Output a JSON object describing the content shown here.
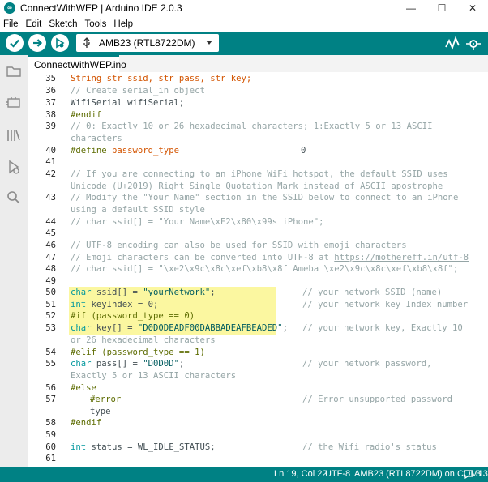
{
  "window": {
    "title": "ConnectWithWEP | Arduino IDE 2.0.3",
    "logo_glyph": "∞",
    "minimize": "—",
    "maximize": "☐",
    "close": "✕"
  },
  "menu": [
    "File",
    "Edit",
    "Sketch",
    "Tools",
    "Help"
  ],
  "toolbar": {
    "board": "AMB23 (RTL8722DM)",
    "accent": "#008184"
  },
  "tab": {
    "label": "ConnectWithWEP.ino"
  },
  "status": {
    "position": "Ln 19, Col 22",
    "encoding": "UTF-8",
    "board_port": "AMB23 (RTL8722DM) on COM13",
    "count": "3"
  },
  "code": {
    "l35_num": "35",
    "l35": "String str_ssid, str_pass, str_key;",
    "l36_num": "36",
    "l36": "// Create serial_in object",
    "l37_num": "37",
    "l37": "WifiSerial wifiSerial;",
    "l38_num": "38",
    "l38": "#endif",
    "l39_num": "39",
    "l39a": "// 0: Exactly 10 or 26 hexadecimal characters; 1:Exactly 5 or 13 ASCII",
    "l39b": "characters",
    "l40_num": "40",
    "l40a": "#define ",
    "l40b": "password_type",
    "l40c": "0",
    "l41_num": "41",
    "l42_num": "42",
    "l42a": "// If you are connecting to an iPhone WiFi hotspot, the default SSID uses",
    "l42b": "Unicode (U+2019) Right Single Quotation Mark instead of ASCII apostrophe",
    "l43_num": "43",
    "l43a": "// Modify the \"Your Name\" section in the SSID below to connect to an iPhone",
    "l43b": "using a default SSID style",
    "l44_num": "44",
    "l44": "// char ssid[] = \"Your Name\\xE2\\x80\\x99s iPhone\";",
    "l45_num": "45",
    "l46_num": "46",
    "l46": "// UTF-8 encoding can also be used for SSID with emoji characters",
    "l47_num": "47",
    "l47a": "// Emoji characters can be converted into UTF-8 at ",
    "l47b": "https://mothereff.in/utf-8",
    "l48_num": "48",
    "l48": "// char ssid[] = \"\\xe2\\x9c\\x8c\\xef\\xb8\\x8f Ameba \\xe2\\x9c\\x8c\\xef\\xb8\\x8f\";",
    "l49_num": "49",
    "l50_num": "50",
    "l50a": "char",
    "l50b": " ssid[] = ",
    "l50c": "\"yourNetwork\"",
    "l50d": ";",
    "l50e": "// your network SSID (name)",
    "l51_num": "51",
    "l51a": "int",
    "l51b": " keyIndex = 0;",
    "l51e": "// your network key Index number",
    "l52_num": "52",
    "l52": "#if (password_type == 0)",
    "l53_num": "53",
    "l53a": "char",
    "l53b": " key[] = ",
    "l53c": "\"D0D0DEADF00DABBADEAFBEADED\"",
    "l53d": ";",
    "l53e": "// your network key, Exactly 10",
    "l53f": "or 26 hexadecimal characters",
    "l54_num": "54",
    "l54": "#elif (password_type == 1)",
    "l55_num": "55",
    "l55a": "char",
    "l55b": " pass[] = ",
    "l55c": "\"D0D0D\"",
    "l55d": ";",
    "l55e": "// your network password,",
    "l55f": "Exactly 5 or 13 ASCII characters",
    "l56_num": "56",
    "l56": "#else",
    "l57_num": "57",
    "l57a": "#error",
    "l57e": "// Error unsupported password",
    "l57f": "type",
    "l58_num": "58",
    "l58": "#endif",
    "l59_num": "59",
    "l60_num": "60",
    "l60a": "int",
    "l60b": " status = WL_IDLE_STATUS;",
    "l60e": "// the Wifi radio's status",
    "l61_num": "61"
  }
}
